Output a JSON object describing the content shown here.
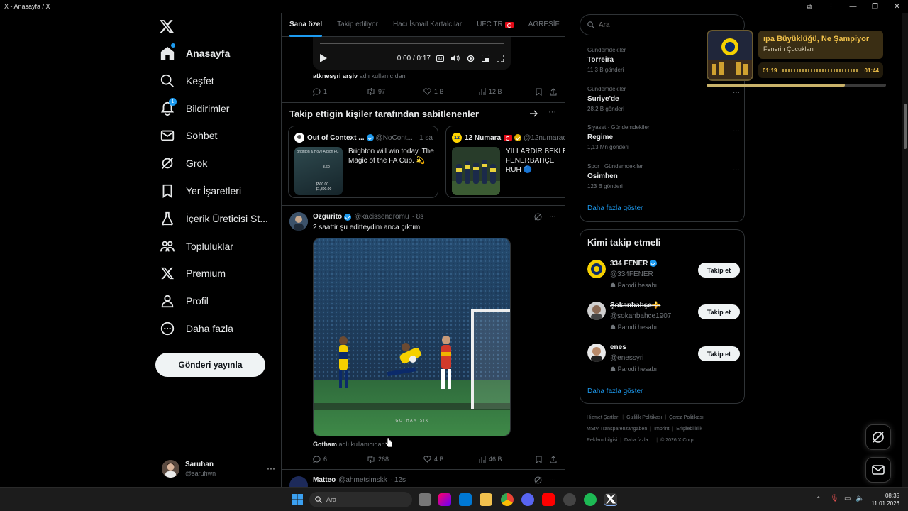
{
  "window": {
    "title": "X - Anasayfa / X"
  },
  "sidebar": {
    "items": [
      {
        "label": "Anasayfa",
        "icon": "home-icon",
        "active": true
      },
      {
        "label": "Keşfet",
        "icon": "search-icon"
      },
      {
        "label": "Bildirimler",
        "icon": "bell-icon",
        "badge": "1"
      },
      {
        "label": "Sohbet",
        "icon": "mail-icon"
      },
      {
        "label": "Grok",
        "icon": "grok-icon"
      },
      {
        "label": "Yer İşaretleri",
        "icon": "bookmark-icon"
      },
      {
        "label": "İçerik Üreticisi St...",
        "icon": "flask-icon"
      },
      {
        "label": "Topluluklar",
        "icon": "communities-icon"
      },
      {
        "label": "Premium",
        "icon": "x-logo-icon"
      },
      {
        "label": "Profil",
        "icon": "person-icon"
      },
      {
        "label": "Daha fazla",
        "icon": "more-circle-icon"
      }
    ],
    "post_button": "Gönderi yayınla",
    "account": {
      "name": "Saruhan",
      "handle": "@saruhwn",
      "more": "···"
    }
  },
  "tabs": [
    "Sana özel",
    "Takip ediliyor",
    "Hacı İsmail Kartalcılar",
    "UFC TR",
    "AGRESİF"
  ],
  "video_top": {
    "time": "0:00 / 0:17",
    "source_name": "atknesyri arşiv",
    "source_suffix": "adlı kullanıcıdan"
  },
  "actions_top": {
    "replies": "1",
    "reposts": "97",
    "likes": "1 B",
    "views": "12 B"
  },
  "pinned": {
    "title": "Takip ettiğin kişiler tarafından sabitlenenler",
    "cards": [
      {
        "name": "Out of Context ...",
        "handle": "@NoCont...",
        "time": "· 1 sa",
        "text": "Brighton will win today. The Magic of the FA Cup. 💫",
        "thumb_text": "Brighton & Hove Albion FC",
        "odds": [
          "3.60",
          "$500.00",
          "$1,800.00"
        ]
      },
      {
        "name": "12 Numara",
        "handle": "@12numarac",
        "text": "YILLARDIR BEKLE FENERBAHÇE RUH 🔵"
      }
    ]
  },
  "post": {
    "name": "Ozgurito",
    "handle": "@kacissendromu",
    "time": "· 8s",
    "text": "2 saattir şu editteydim anca çıktım",
    "watermark": "GOTHAM SIR",
    "source_name": "Gotham",
    "source_suffix": "adlı kullanıcıdan",
    "actions": {
      "replies": "6",
      "reposts": "268",
      "likes": "4 B",
      "views": "46 B"
    }
  },
  "next_post": {
    "name": "Matteo",
    "handle": "@ahmetsimskk",
    "time": "· 12s"
  },
  "search": {
    "placeholder": "Ara"
  },
  "trends": [
    {
      "context": "Gündemdekiler",
      "title": "Torreira",
      "count": "11,3 B gönderi"
    },
    {
      "context": "Gündemdekiler",
      "title": "Suriye'de",
      "count": "28,2 B gönderi"
    },
    {
      "context": "Siyaset · Gündemdekiler",
      "title": "Regime",
      "count": "1,13 Mn gönderi"
    },
    {
      "context": "Spor · Gündemdekiler",
      "title": "Osimhen",
      "count": "123 B gönderi"
    }
  ],
  "trends_more": "Daha fazla göster",
  "who_to_follow": {
    "title": "Kimi takip etmeli",
    "users": [
      {
        "name": "334 FENER",
        "handle": "@334FENER",
        "label": "Parodi hesabı",
        "button": "Takip et"
      },
      {
        "name": "Şokanbahçe⚜️",
        "handle": "@sokanbahce1907",
        "label": "Parodi hesabı",
        "button": "Takip et"
      },
      {
        "name": "enes",
        "handle": "@enessyri",
        "label": "Parodi hesabı",
        "button": "Takip et"
      }
    ],
    "more": "Daha fazla göster"
  },
  "footer": [
    "Hizmet Şartları",
    "Gizlilik Politikası",
    "Çerez Politikası",
    "MStV Transparenzangaben",
    "Imprint",
    "Erişilebilirlik",
    "Reklam bilgisi",
    "Daha fazla ...",
    "© 2026 X Corp."
  ],
  "media": {
    "title": "ıpa Büyüklüğü, Ne Şampiyor",
    "artist": "Fenerin Çocukları",
    "elapsed": "01:19",
    "duration": "01:44",
    "progress": 0.77
  },
  "taskbar": {
    "search": "Ara",
    "time": "08:35",
    "date": "11.01.2026"
  },
  "colors": {
    "accent": "#1d9bf0",
    "background": "#000000",
    "border": "#2f3336",
    "muted": "#71767b"
  }
}
